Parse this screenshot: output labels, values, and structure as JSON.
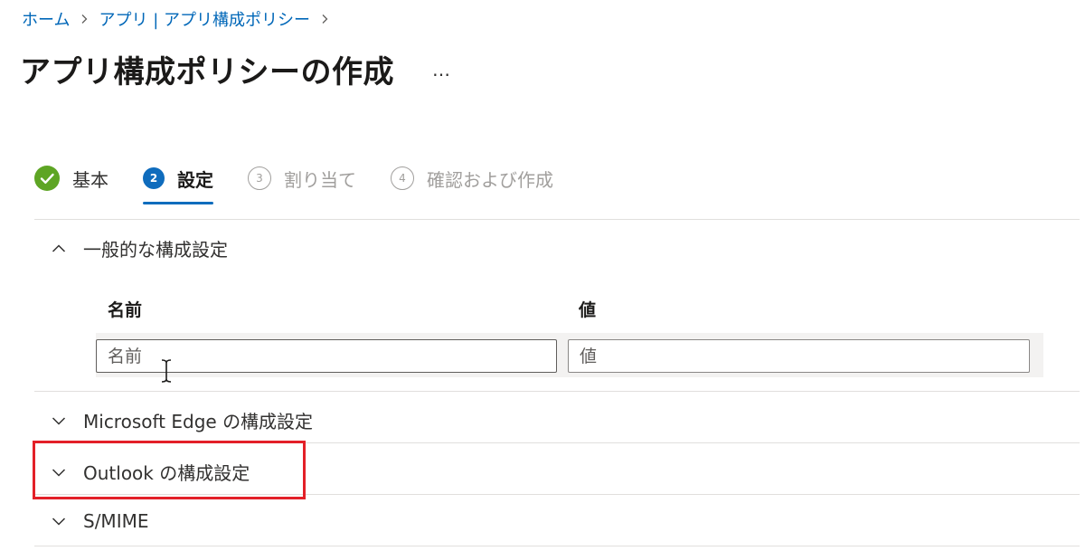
{
  "breadcrumb": {
    "home": "ホーム",
    "apps": "アプリ | アプリ構成ポリシー"
  },
  "title": "アプリ構成ポリシーの作成",
  "more_label": "…",
  "steps": [
    {
      "number": "",
      "label": "基本",
      "state": "done"
    },
    {
      "number": "2",
      "label": "設定",
      "state": "active"
    },
    {
      "number": "3",
      "label": "割り当て",
      "state": "todo"
    },
    {
      "number": "4",
      "label": "確認および作成",
      "state": "todo"
    }
  ],
  "sections": {
    "general": {
      "label": "一般的な構成設定",
      "expanded": true
    },
    "edge": {
      "label": "Microsoft Edge の構成設定",
      "expanded": false
    },
    "outlook": {
      "label": "Outlook の構成設定",
      "expanded": false
    },
    "smime": {
      "label": "S/MIME",
      "expanded": false
    }
  },
  "table": {
    "name_header": "名前",
    "value_header": "値",
    "name_placeholder": "名前",
    "value_placeholder": "値"
  },
  "colors": {
    "link": "#0067b8",
    "accent": "#0f6cbd",
    "success": "#5ea524",
    "highlight": "#e32028"
  },
  "icons": {
    "breadcrumb_separator": "chevron-right-icon",
    "step_done": "checkmark-icon",
    "expanded": "chevron-up-icon",
    "collapsed": "chevron-down-icon",
    "cursor": "text-cursor-icon"
  }
}
